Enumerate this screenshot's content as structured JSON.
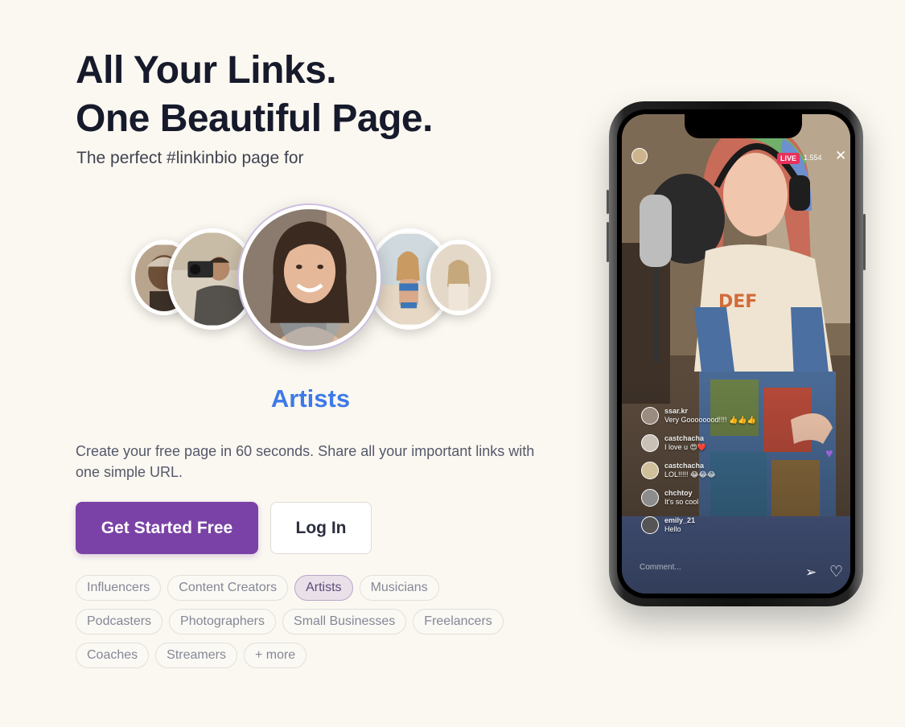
{
  "hero": {
    "title_line1": "All Your Links.",
    "title_line2": "One Beautiful Page.",
    "subtitle": "The perfect #linkinbio page for"
  },
  "carousel": {
    "active_category": "Artists"
  },
  "description": "Create your free page in 60 seconds. Share all your important links with one simple URL.",
  "buttons": {
    "primary": "Get Started Free",
    "secondary": "Log In"
  },
  "categories": [
    [
      "Influencers",
      "Content Creators",
      "Artists",
      "Musicians"
    ],
    [
      "Podcasters",
      "Photographers",
      "Small Businesses",
      "Freelancers"
    ],
    [
      "Coaches",
      "Streamers",
      "+ more"
    ]
  ],
  "phone": {
    "live_badge": "LIVE",
    "viewers": "1.554",
    "comments": [
      {
        "user": "ssar.kr",
        "text": "Very Goooooood!!!! 👍👍👍"
      },
      {
        "user": "castchacha",
        "text": "I love u 😍❤️"
      },
      {
        "user": "castchacha",
        "text": "LOL!!!!! 😂😂😂"
      },
      {
        "user": "chchtoy",
        "text": "It's so cool"
      },
      {
        "user": "emily_21",
        "text": "Hello"
      }
    ],
    "input_placeholder": "Comment..."
  },
  "colors": {
    "background": "#fbf8f1",
    "primary_button": "#7a42a6",
    "category_label": "#3d7ae8",
    "active_chip": "#e9e0ea"
  }
}
